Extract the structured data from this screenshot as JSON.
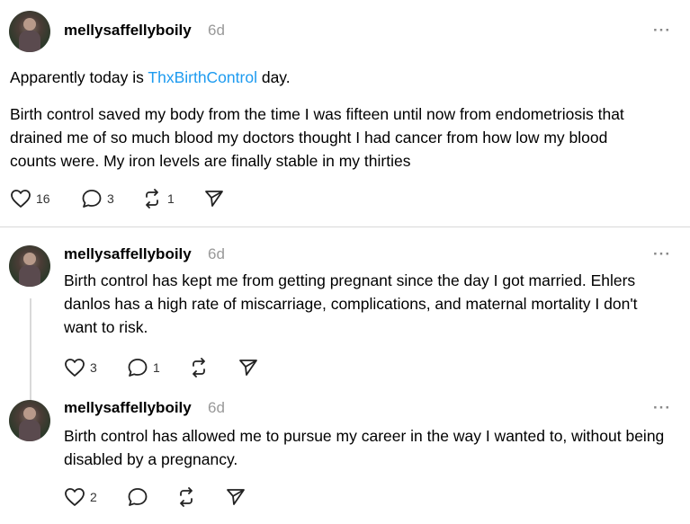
{
  "posts": [
    {
      "username": "mellysaffellyboily",
      "time": "6d",
      "more": "···",
      "line1_prefix": "Apparently today is ",
      "line1_link": "ThxBirthControl",
      "line1_suffix": " day.",
      "body": "Birth control saved my body from the time I was fifteen until now from endometriosis that drained me of so much blood my doctors thought I had cancer from how low my blood counts were. My iron levels are finally stable in my thirties",
      "likes": "16",
      "replies": "3",
      "reposts": "1"
    },
    {
      "username": "mellysaffellyboily",
      "time": "6d",
      "more": "···",
      "body": "Birth control has kept me from getting pregnant since the day I got married. Ehlers danlos has a high rate of miscarriage, complications, and maternal mortality I don't want to risk.",
      "likes": "3",
      "replies": "1",
      "reposts": ""
    },
    {
      "username": "mellysaffellyboily",
      "time": "6d",
      "more": "···",
      "body": "Birth control has allowed me to pursue my career in the way I wanted to, without being disabled by a pregnancy.",
      "likes": "2",
      "replies": "",
      "reposts": ""
    }
  ],
  "colors": {
    "link": "#1d9bf0",
    "muted": "#999999",
    "divider": "#d9d9d9"
  },
  "icons": [
    "heart-icon",
    "comment-icon",
    "repost-icon",
    "share-icon",
    "more-icon"
  ]
}
